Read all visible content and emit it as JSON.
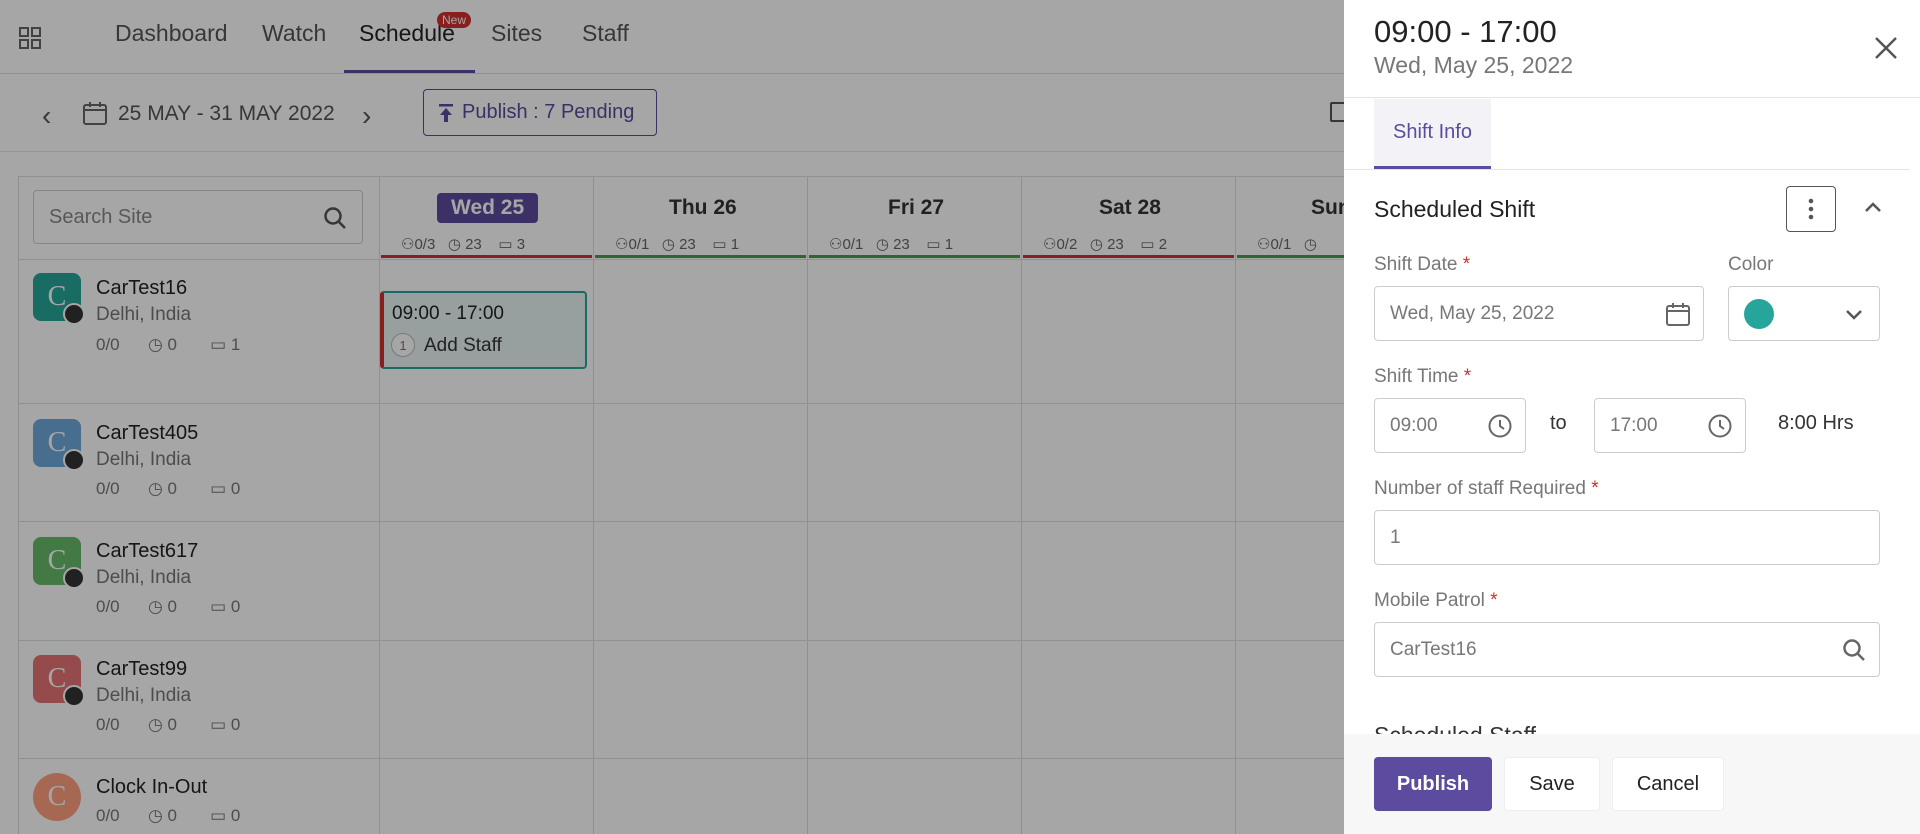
{
  "nav": {
    "items": [
      "Dashboard",
      "Watch",
      "Schedule",
      "Sites",
      "Staff"
    ],
    "new_badge": "New"
  },
  "toolbar": {
    "date_range": "25 MAY - 31 MAY 2022",
    "publish_label": "Publish : 7 Pending"
  },
  "calendar": {
    "search_placeholder": "Search Site",
    "days": [
      {
        "label": "Wed 25",
        "staff": "0/3",
        "hours": "23",
        "shifts": "3",
        "status_color": "#d32f2f"
      },
      {
        "label": "Thu 26",
        "staff": "0/1",
        "hours": "23",
        "shifts": "1",
        "status_color": "#43a047"
      },
      {
        "label": "Fri 27",
        "staff": "0/1",
        "hours": "23",
        "shifts": "1",
        "status_color": "#43a047"
      },
      {
        "label": "Sat 28",
        "staff": "0/2",
        "hours": "23",
        "shifts": "2",
        "status_color": "#d32f2f"
      },
      {
        "label": "Sun",
        "staff": "0/1",
        "hours": "",
        "shifts": "",
        "status_color": "#43a047"
      }
    ],
    "sites": [
      {
        "name": "CarTest16",
        "location": "Delhi, India",
        "staff": "0/0",
        "hours": "0",
        "shifts": "1",
        "avatar_letter": "C",
        "avatar_color": "#26a69a"
      },
      {
        "name": "CarTest405",
        "location": "Delhi, India",
        "staff": "0/0",
        "hours": "0",
        "shifts": "0",
        "avatar_letter": "C",
        "avatar_color": "#6ea8dc"
      },
      {
        "name": "CarTest617",
        "location": "Delhi, India",
        "staff": "0/0",
        "hours": "0",
        "shifts": "0",
        "avatar_letter": "C",
        "avatar_color": "#66bb6a"
      },
      {
        "name": "CarTest99",
        "location": "Delhi, India",
        "staff": "0/0",
        "hours": "0",
        "shifts": "0",
        "avatar_letter": "C",
        "avatar_color": "#e57373"
      },
      {
        "name": "Clock In-Out",
        "location": "",
        "staff": "0/0",
        "hours": "0",
        "shifts": "0",
        "avatar_letter": "C",
        "avatar_color": "#ff9e80"
      }
    ],
    "shift_card": {
      "time": "09:00 - 17:00",
      "count": "1",
      "action": "Add Staff"
    }
  },
  "panel": {
    "title": "09:00 - 17:00",
    "subtitle": "Wed, May 25, 2022",
    "tab": "Shift Info",
    "section_title": "Scheduled Shift",
    "shift_date_label": "Shift Date",
    "shift_date_value": "Wed, May 25, 2022",
    "color_label": "Color",
    "color_value": "#26a69a",
    "shift_time_label": "Shift Time",
    "start_time": "09:00",
    "to": "to",
    "end_time": "17:00",
    "duration": "8:00 Hrs",
    "staff_required_label": "Number of staff Required",
    "staff_required_value": "1",
    "mobile_patrol_label": "Mobile Patrol",
    "mobile_patrol_value": "CarTest16",
    "next_section": "Scheduled Staff",
    "required_mark": "*",
    "buttons": {
      "publish": "Publish",
      "save": "Save",
      "cancel": "Cancel"
    }
  }
}
